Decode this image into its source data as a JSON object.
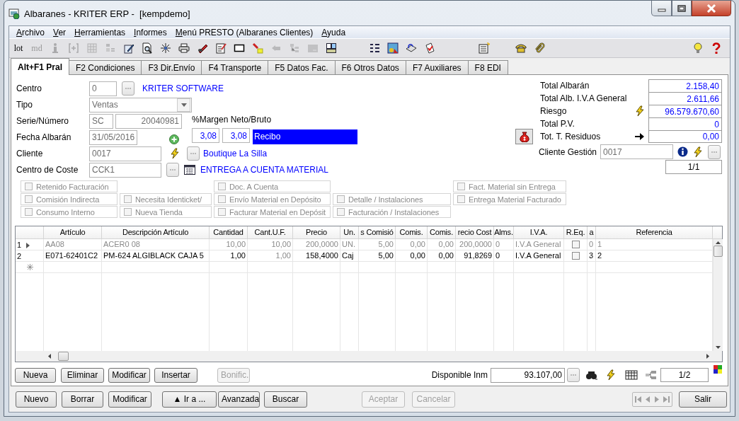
{
  "window": {
    "title": "Albaranes - KRITER ERP -  [kempdemo]"
  },
  "menu": [
    "Archivo",
    "Ver",
    "Herramientas",
    "Informes",
    "Menú PRESTO (Albaranes Clientes)",
    "Ayuda"
  ],
  "toolbar": [
    [
      {
        "kind": "text",
        "label": "lot",
        "disabled": false
      },
      {
        "kind": "text",
        "label": "md",
        "disabled": true
      },
      {
        "kind": "info",
        "disabled": true
      },
      {
        "kind": "columns",
        "disabled": true
      },
      {
        "kind": "table",
        "disabled": true
      },
      {
        "kind": "grid",
        "disabled": true
      },
      {
        "kind": "edit",
        "disabled": false
      },
      {
        "kind": "preview",
        "disabled": false
      },
      {
        "kind": "sparkle",
        "disabled": false
      },
      {
        "kind": "printer",
        "disabled": false
      },
      {
        "kind": "tool",
        "disabled": false
      },
      {
        "kind": "note",
        "disabled": false
      },
      {
        "kind": "frame",
        "disabled": false
      },
      {
        "kind": "marker",
        "disabled": false
      },
      {
        "kind": "back",
        "disabled": true
      },
      {
        "kind": "tree",
        "disabled": true
      },
      {
        "kind": "panel",
        "disabled": true
      },
      {
        "kind": "layout",
        "disabled": false
      }
    ],
    [
      {
        "kind": "list",
        "disabled": false
      },
      {
        "kind": "picture",
        "disabled": false
      },
      {
        "kind": "disk",
        "disabled": false
      },
      {
        "kind": "check",
        "disabled": false
      }
    ],
    [
      {
        "kind": "newlist",
        "disabled": false
      }
    ],
    [
      {
        "kind": "phone",
        "disabled": false
      },
      {
        "kind": "clip",
        "disabled": false
      }
    ],
    [
      {
        "kind": "bulb",
        "disabled": false
      },
      {
        "kind": "help",
        "disabled": false
      }
    ]
  ],
  "tabs": [
    {
      "label": "Alt+F1 Pral",
      "selected": true
    },
    {
      "label": "F2 Condiciones",
      "selected": false
    },
    {
      "label": "F3 Dir.Envío",
      "selected": false
    },
    {
      "label": "F4 Transporte",
      "selected": false
    },
    {
      "label": "F5 Datos Fac.",
      "selected": false
    },
    {
      "label": "F6 Otros Datos",
      "selected": false
    },
    {
      "label": "F7 Auxiliares",
      "selected": false
    },
    {
      "label": "F8 EDI",
      "selected": false
    }
  ],
  "header": {
    "centro": {
      "label": "Centro",
      "value": "0",
      "name": "KRITER SOFTWARE"
    },
    "tipo": {
      "label": "Tipo",
      "value": "Ventas"
    },
    "serie_numero": {
      "label": "Serie/Número",
      "serie": "SC",
      "numero": "20040981"
    },
    "fecha": {
      "label": "Fecha Albarán",
      "value": "31/05/2016"
    },
    "cliente": {
      "label": "Cliente",
      "value": "0017",
      "name": "Boutique La Silla"
    },
    "centro_coste": {
      "label": "Centro de Coste",
      "value": "CCK1",
      "name": "ENTREGA A CUENTA MATERIAL"
    },
    "margin": {
      "label": "%Margen Neto/Bruto",
      "neto": "3,08",
      "bruto": "3,08",
      "status": "Recibo"
    },
    "totals": [
      {
        "label": "Total Albarán",
        "value": "2.158,40",
        "kind": "plain"
      },
      {
        "label": "Total Alb. I.V.A General",
        "value": "2.611,66",
        "kind": "plain"
      },
      {
        "label": "Riesgo",
        "value": "96.579.670,60",
        "kind": "alert"
      },
      {
        "label": "Total P.V.",
        "value": "0",
        "kind": "plain"
      },
      {
        "label": "Tot. T. Residuos",
        "value": "0,00",
        "kind": "transfer"
      }
    ],
    "cliente_gestion": {
      "label": "Cliente Gestión",
      "value": "0017"
    },
    "record_position": "1/1",
    "checkbox_rows": [
      [
        {
          "label": "Retenido Facturación",
          "checked": false
        },
        null,
        {
          "label": "Doc. A Cuenta",
          "checked": false
        },
        null,
        {
          "label": "Fact. Material sin Entrega",
          "checked": false
        }
      ],
      [
        {
          "label": "Comisión Indirecta",
          "checked": false
        },
        {
          "label": "Necesita Identicket/",
          "checked": false
        },
        {
          "label": "Envío Material en Depósito",
          "checked": false
        },
        {
          "label": "Detalle / Instalaciones",
          "checked": false
        },
        {
          "label": "Entrega Material Facturado",
          "checked": false
        }
      ],
      [
        {
          "label": "Consumo Interno",
          "checked": false
        },
        {
          "label": "Nueva Tienda",
          "checked": false
        },
        {
          "label": "Facturar Material en Depósit",
          "checked": false
        },
        {
          "label": "Facturación / Instalaciones",
          "checked": false
        },
        null
      ]
    ]
  },
  "grid": {
    "columns": [
      {
        "label": "Artículo",
        "kind": "text"
      },
      {
        "label": "Descripción Artículo",
        "kind": "text"
      },
      {
        "label": "Cantidad",
        "kind": "number"
      },
      {
        "label": "Cant.U.F.",
        "kind": "readonly"
      },
      {
        "label": "Precio",
        "kind": "number"
      },
      {
        "label": "Un.",
        "kind": "text"
      },
      {
        "label": "s Comisió",
        "kind": "number"
      },
      {
        "label": "Comis.",
        "kind": "number"
      },
      {
        "label": "Comis.",
        "kind": "number"
      },
      {
        "label": "recio Cost",
        "kind": "number"
      },
      {
        "label": "Alms.",
        "kind": "text"
      },
      {
        "label": "I.V.A.",
        "kind": "text"
      },
      {
        "label": "R.Eq.",
        "kind": "check"
      },
      {
        "label": "a",
        "kind": "text"
      },
      {
        "label": "Referencia",
        "kind": "text"
      }
    ],
    "rows": [
      {
        "number": "1",
        "selected": true,
        "r_eq": false,
        "cells": [
          "AA08",
          "ACER0 08",
          "10,00",
          "10,00",
          "200,0000",
          "UN.",
          "5,00",
          "0,00",
          "0,00",
          "200,0000",
          "0",
          "I.V.A General",
          "",
          "0",
          "1"
        ]
      },
      {
        "number": "2",
        "selected": false,
        "r_eq": false,
        "cells": [
          "E071-62401C2",
          "PM-624 ALGIBLACK CAJA 5",
          "1,00",
          "1,00",
          "158,4000",
          "Caj",
          "5,00",
          "0,00",
          "0,00",
          "91,8269",
          "0",
          "I.V.A General",
          "",
          "3",
          "2"
        ]
      }
    ]
  },
  "line_actions": {
    "buttons": [
      {
        "label": "Nueva",
        "disabled": false
      },
      {
        "label": "Eliminar",
        "disabled": false
      },
      {
        "label": "Modificar",
        "disabled": false
      },
      {
        "label": "Insertar",
        "disabled": false
      },
      {
        "label": "Bonific.",
        "disabled": true
      }
    ],
    "disponible": {
      "label": "Disponible Inm",
      "value": "93.107,00"
    },
    "page": "1/2"
  },
  "footer": {
    "buttons": [
      {
        "label": "Nuevo",
        "disabled": false
      },
      {
        "label": "Borrar",
        "disabled": false
      },
      {
        "label": "Modificar",
        "disabled": false
      },
      {
        "label": "▲ Ir a ...",
        "disabled": false
      },
      {
        "label": "Avanzada",
        "disabled": false
      },
      {
        "label": "Buscar",
        "disabled": false
      },
      {
        "label": "Aceptar",
        "disabled": true
      },
      {
        "label": "Cancelar",
        "disabled": true
      }
    ],
    "exit": "Salir"
  }
}
